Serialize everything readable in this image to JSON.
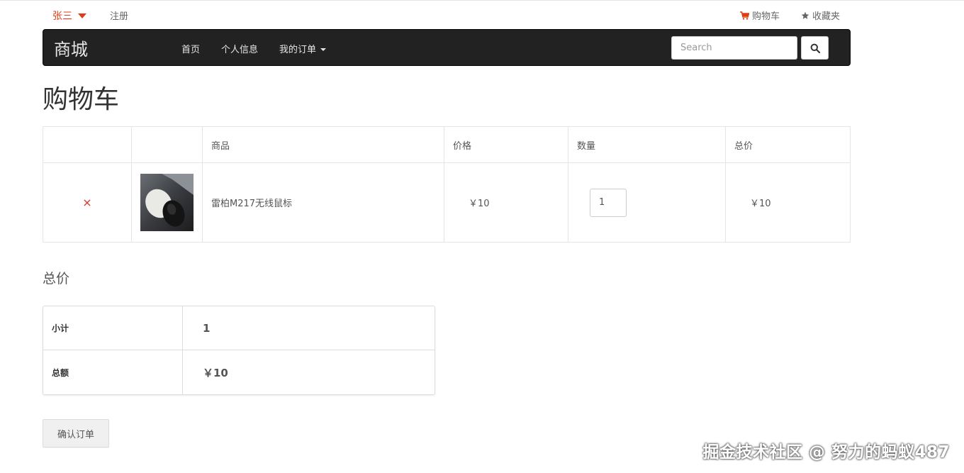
{
  "topbar": {
    "user_name": "张三",
    "register": "注册",
    "cart": "购物车",
    "favorites": "收藏夹"
  },
  "navbar": {
    "brand": "商城",
    "items": [
      {
        "label": "首页"
      },
      {
        "label": "个人信息"
      },
      {
        "label": "我的订单"
      }
    ],
    "search": {
      "placeholder": "Search",
      "value": ""
    }
  },
  "page": {
    "title": "购物车"
  },
  "cart": {
    "headers": [
      "",
      "",
      "商品",
      "价格",
      "数量",
      "总价"
    ],
    "rows": [
      {
        "name": "雷柏M217无线鼠标",
        "price": "￥10",
        "quantity": "1",
        "total": "￥10",
        "remove": "×"
      }
    ]
  },
  "totals": {
    "title": "总价",
    "subtotal_label": "小计",
    "subtotal_value": "1",
    "total_label": "总额",
    "total_value": "￥10"
  },
  "actions": {
    "confirm": "确认订单"
  },
  "watermark": "掘金技术社区 @ 努力的蚂蚁487",
  "colors": {
    "accent": "#dd3f15",
    "navbar_bg": "#222222",
    "remove": "#d9302c"
  }
}
